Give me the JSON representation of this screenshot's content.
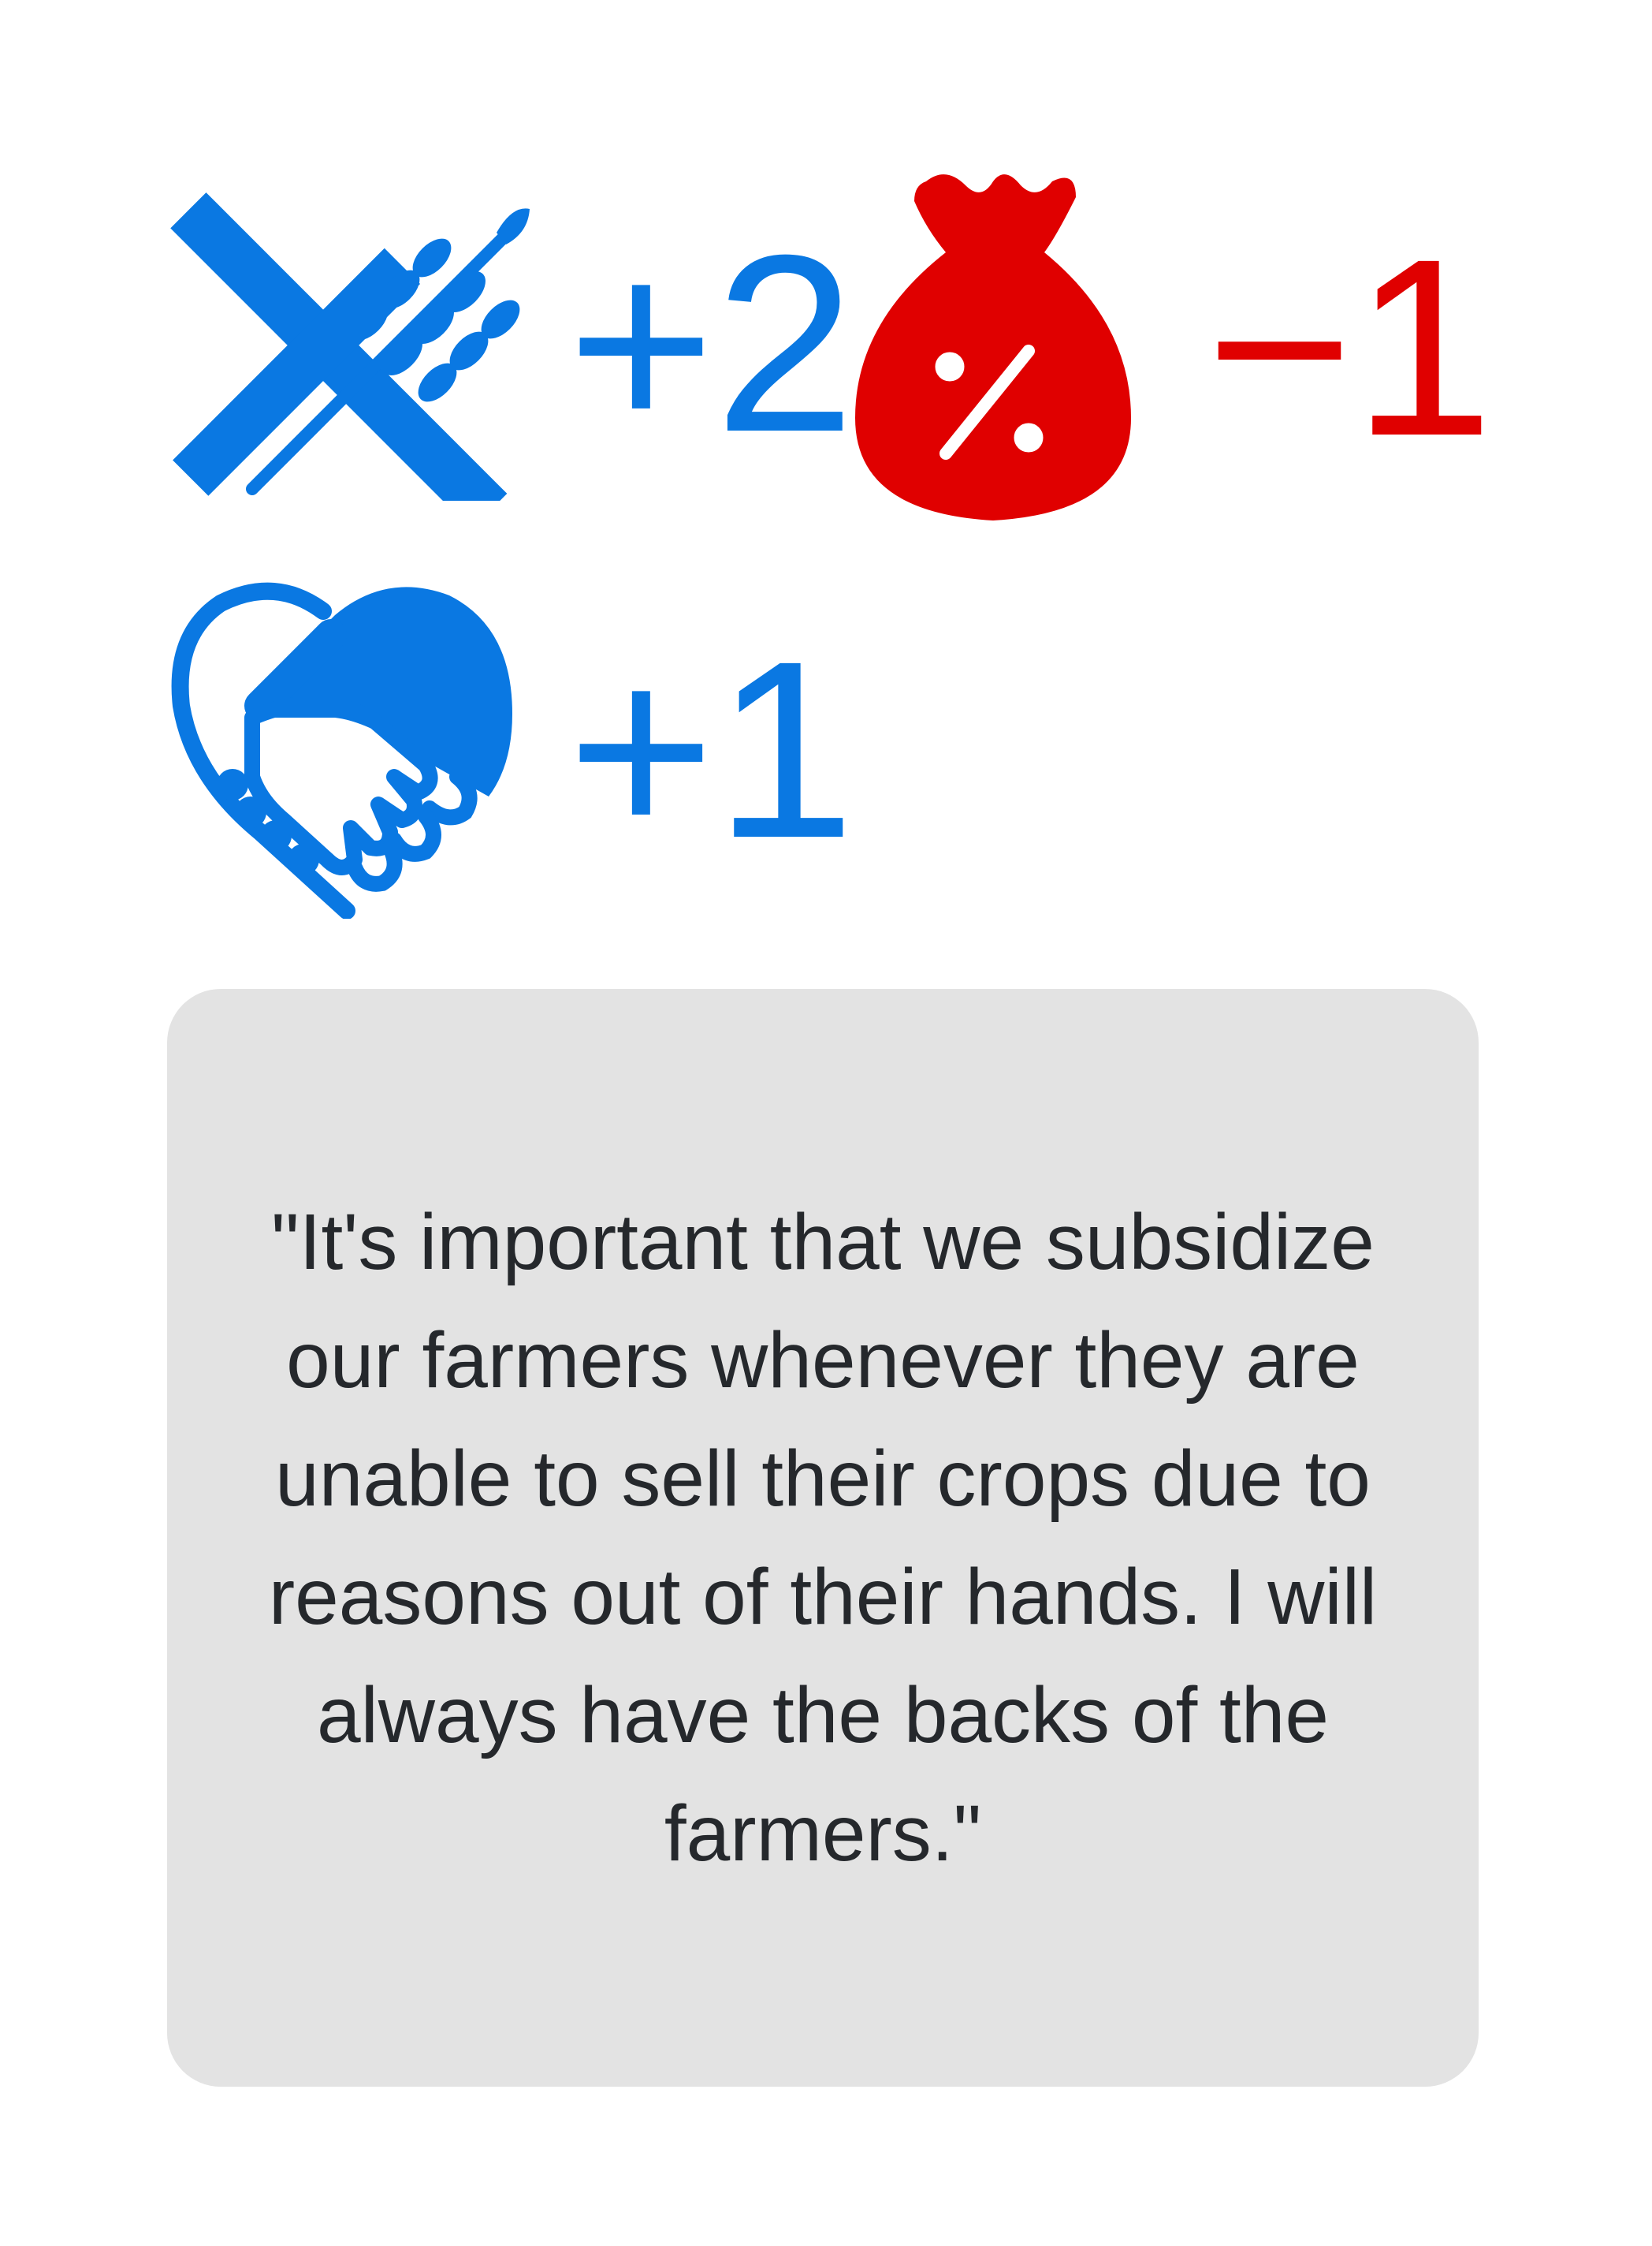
{
  "colors": {
    "positive": "#0a78e2",
    "negative": "#e00000",
    "card_background": "#e3e3e3",
    "quote_text": "#25282c"
  },
  "stats": [
    {
      "icon": "no-wheat-icon",
      "value": "+2",
      "color": "#0a78e2"
    },
    {
      "icon": "tax-money-bag-icon",
      "value": "−1",
      "color": "#e00000"
    },
    {
      "icon": "heart-handshake-icon",
      "value": "+1",
      "color": "#0a78e2"
    }
  ],
  "quote": "\"It's important that we subsidize our farmers whenever they are unable to sell their crops due to reasons out of their hands. I will always have the backs of the farmers.\""
}
